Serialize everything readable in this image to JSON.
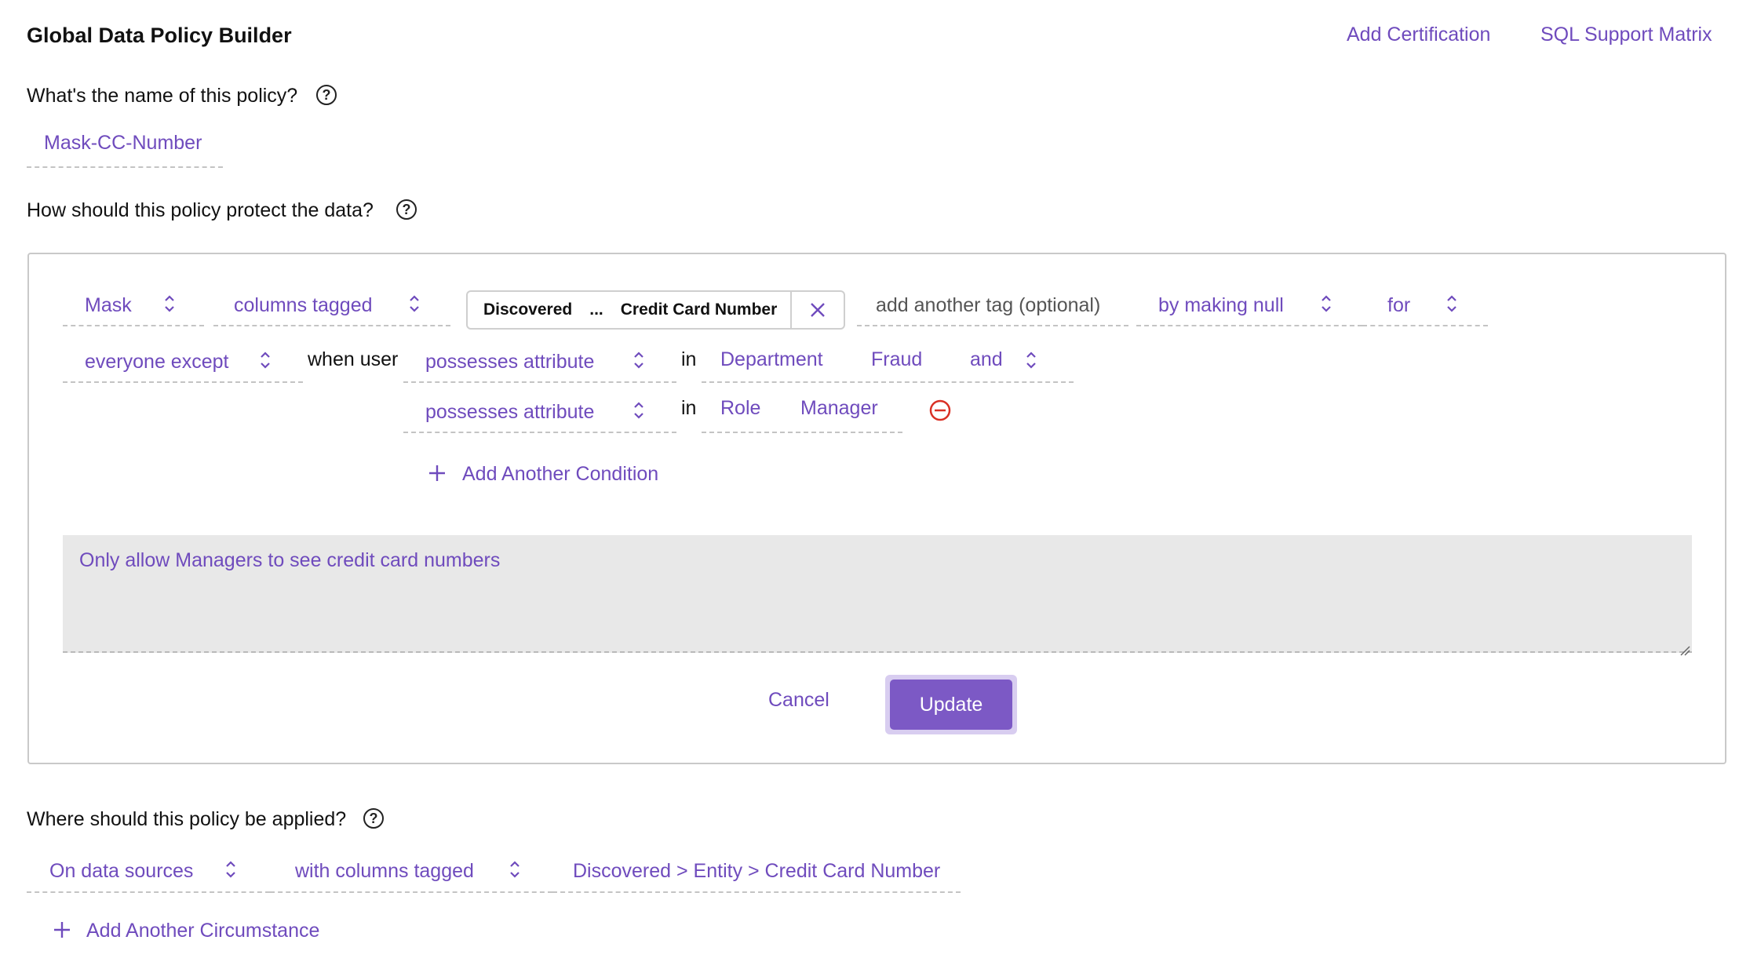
{
  "header": {
    "title": "Global Data Policy Builder",
    "add_certification": "Add Certification",
    "sql_support_matrix": "SQL Support Matrix"
  },
  "name_section": {
    "question": "What's the name of this policy?",
    "value": "Mask-CC-Number"
  },
  "protect_section": {
    "question": "How should this policy protect the data?",
    "action": "Mask",
    "target": "columns tagged",
    "tag_chip": {
      "prefix": "Discovered",
      "ellipsis": "...",
      "name": "Credit Card Number"
    },
    "add_tag_placeholder": "add another tag (optional)",
    "method": "by making null",
    "for_label": "for",
    "audience": "everyone except",
    "when_user": "when user",
    "conditions": [
      {
        "type": "possesses attribute",
        "in": "in",
        "attribute": "Department",
        "value": "Fraud",
        "join": "and"
      },
      {
        "type": "possesses attribute",
        "in": "in",
        "attribute": "Role",
        "value": "Manager"
      }
    ],
    "add_condition": "Add Another Condition",
    "rationale": "Only allow Managers to see credit card numbers",
    "cancel": "Cancel",
    "update": "Update"
  },
  "apply_section": {
    "question": "Where should this policy be applied?",
    "scope": "On data sources",
    "filter": "with columns tagged",
    "tag_path": "Discovered > Entity > Credit Card Number",
    "add_circumstance": "Add Another Circumstance"
  },
  "colors": {
    "accent": "#6f4bbd",
    "button": "#7c59c5",
    "remove": "#d93025"
  }
}
